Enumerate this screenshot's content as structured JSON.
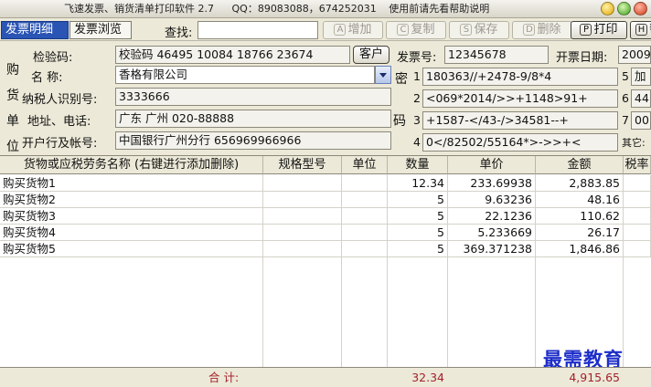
{
  "window": {
    "title": "飞速发票、销货清单打印软件 2.7",
    "qq": "QQ：89083088，674252031",
    "note": "使用前请先看帮助说明"
  },
  "toolbar": {
    "tabs": [
      {
        "label": "发票明细",
        "active": true
      },
      {
        "label": "发票浏览",
        "active": false
      }
    ],
    "search_label": "查找:",
    "search_value": "",
    "buttons": [
      {
        "key": "A",
        "label": "增加",
        "enabled": false
      },
      {
        "key": "C",
        "label": "复制",
        "enabled": false
      },
      {
        "key": "S",
        "label": "保存",
        "enabled": false
      },
      {
        "key": "D",
        "label": "删除",
        "enabled": false
      },
      {
        "key": "P",
        "label": "打印",
        "enabled": true
      },
      {
        "key": "H",
        "label": "帮",
        "enabled": true
      }
    ]
  },
  "buyer": {
    "vertical_label": [
      "购",
      "货",
      "单",
      "位"
    ],
    "check_label": "检验码:",
    "check_value": "校验码 46495 10084 18766 23674",
    "customer_button": "客户",
    "name_label": "名    称:",
    "name_value": "香格有限公司",
    "tax_label": "纳税人识别号:",
    "tax_value": "3333666",
    "address_label": "地址、电话:",
    "address_value": "广东 广州  020-88888",
    "bank_label": "开户行及帐号:",
    "bank_value": "中国银行广州分行 656969966966"
  },
  "invoice": {
    "no_label": "发票号:",
    "no_value": "12345678",
    "date_label": "开票日期:",
    "date_value": "2009",
    "cipher_label": [
      "密",
      "码"
    ],
    "cipher_rows": [
      {
        "idx": "1",
        "value": "180363//+2478-9/8*4"
      },
      {
        "idx": "2",
        "value": "<069*2014/>>+1148>91+"
      },
      {
        "idx": "3",
        "value": "+1587-</43-/>34581--+"
      },
      {
        "idx": "4",
        "value": "0</82502/55164*>->>+<"
      }
    ],
    "extra_rows": [
      {
        "idx": "5",
        "value": "加"
      },
      {
        "idx": "6",
        "value": "44"
      },
      {
        "idx": "7",
        "value": "00"
      }
    ],
    "other_label": "其它:"
  },
  "table": {
    "headers": [
      "货物或应税劳务名称 (右键进行添加删除)",
      "规格型号",
      "单位",
      "数量",
      "单价",
      "金额",
      "税率"
    ],
    "rows": [
      {
        "name": "购买货物1",
        "spec": "",
        "unit": "",
        "qty": "12.34",
        "price": "233.69938",
        "amount": "2,883.85"
      },
      {
        "name": "购买货物2",
        "spec": "",
        "unit": "",
        "qty": "5",
        "price": "9.63236",
        "amount": "48.16"
      },
      {
        "name": "购买货物3",
        "spec": "",
        "unit": "",
        "qty": "5",
        "price": "22.1236",
        "amount": "110.62"
      },
      {
        "name": "购买货物4",
        "spec": "",
        "unit": "",
        "qty": "5",
        "price": "5.233669",
        "amount": "26.17"
      },
      {
        "name": "购买货物5",
        "spec": "",
        "unit": "",
        "qty": "5",
        "price": "369.371238",
        "amount": "1,846.86"
      }
    ],
    "total_label": "合  计:",
    "total_qty": "32.34",
    "total_amount": "4,915.65"
  },
  "watermark": "最需教育"
}
